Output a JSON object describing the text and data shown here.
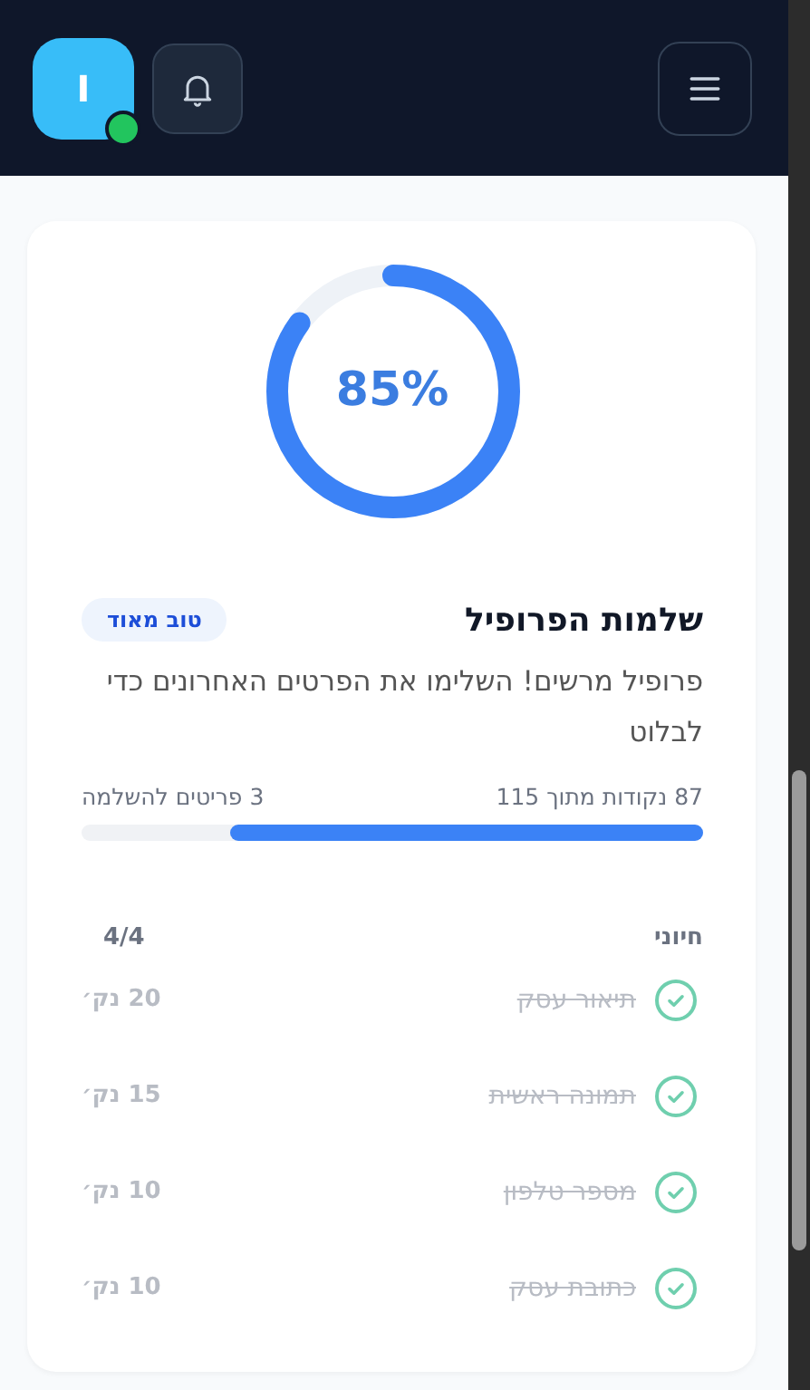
{
  "header": {
    "avatar": {
      "letter": "I",
      "online": true
    }
  },
  "completion": {
    "level": 0.85,
    "percent": "85%",
    "title": "שלמות הפרופיל",
    "badge": "טוב מאוד",
    "message": "פרופיל מרשים! השלימו את הפרטים האחרונים כדי לבלוט",
    "points": "87 נקודות מתוך 115",
    "remaining": "3 פריטים להשלמה",
    "bar": {
      "level": 0.76
    }
  },
  "section": {
    "title": "חיוני",
    "count": "4/4",
    "items": [
      {
        "label": "תיאור עסק",
        "points": "20 נק׳",
        "done": true
      },
      {
        "label": "תמונה ראשית",
        "points": "15 נק׳",
        "done": true
      },
      {
        "label": "מספר טלפון",
        "points": "10 נק׳",
        "done": true
      },
      {
        "label": "כתובת עסק",
        "points": "10 נק׳",
        "done": true
      }
    ]
  }
}
